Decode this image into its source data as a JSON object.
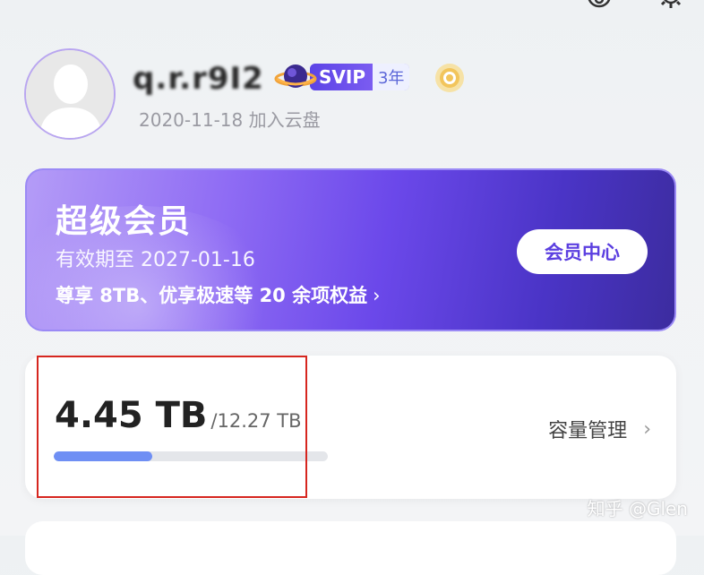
{
  "header": {
    "icons": [
      "headset-icon",
      "settings-gear-icon"
    ]
  },
  "profile": {
    "username": "q.r.r9I2",
    "badge_label": "SVIP",
    "badge_years": "3年",
    "joined": "2020-11-18 加入云盘"
  },
  "vip_card": {
    "title": "超级会员",
    "expire": "有效期至 2027-01-16",
    "benefits": "尊享 8TB、优享极速等 20 余项权益",
    "chevron": "›",
    "center_button": "会员中心"
  },
  "storage": {
    "used": "4.45 TB",
    "total": "/12.27 TB",
    "used_fraction": 0.36,
    "manage_label": "容量管理",
    "chevron": "›"
  },
  "watermark": "知乎 @Glen",
  "colors": {
    "accent": "#6b48ea",
    "progress": "#6f8ff4",
    "highlight": "#d6261f"
  }
}
